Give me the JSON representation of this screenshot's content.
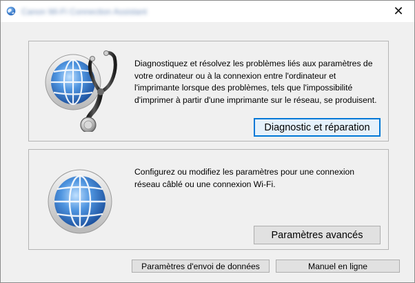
{
  "window": {
    "title": "Canon Wi-Fi Connection Assistant",
    "close_glyph": "✕"
  },
  "panels": [
    {
      "description": "Diagnostiquez et résolvez les problèmes liés aux paramètres de votre ordinateur ou à la connexion entre l'ordinateur et l'imprimante lorsque des problèmes, tels que l'impossibilité d'imprimer à partir d'une imprimante sur le réseau, se produisent.",
      "button_label": "Diagnostic et réparation",
      "icon": "globe-stethoscope-icon"
    },
    {
      "description": "Configurez ou modifiez les paramètres pour une connexion réseau câblé ou une connexion Wi-Fi.",
      "button_label": "Paramètres avancés",
      "icon": "globe-icon"
    }
  ],
  "footer": {
    "send_data_label": "Paramètres d'envoi de données",
    "online_manual_label": "Manuel en ligne"
  },
  "colors": {
    "focus_accent": "#0078d7",
    "globe_blue": "#2f6fc4"
  }
}
